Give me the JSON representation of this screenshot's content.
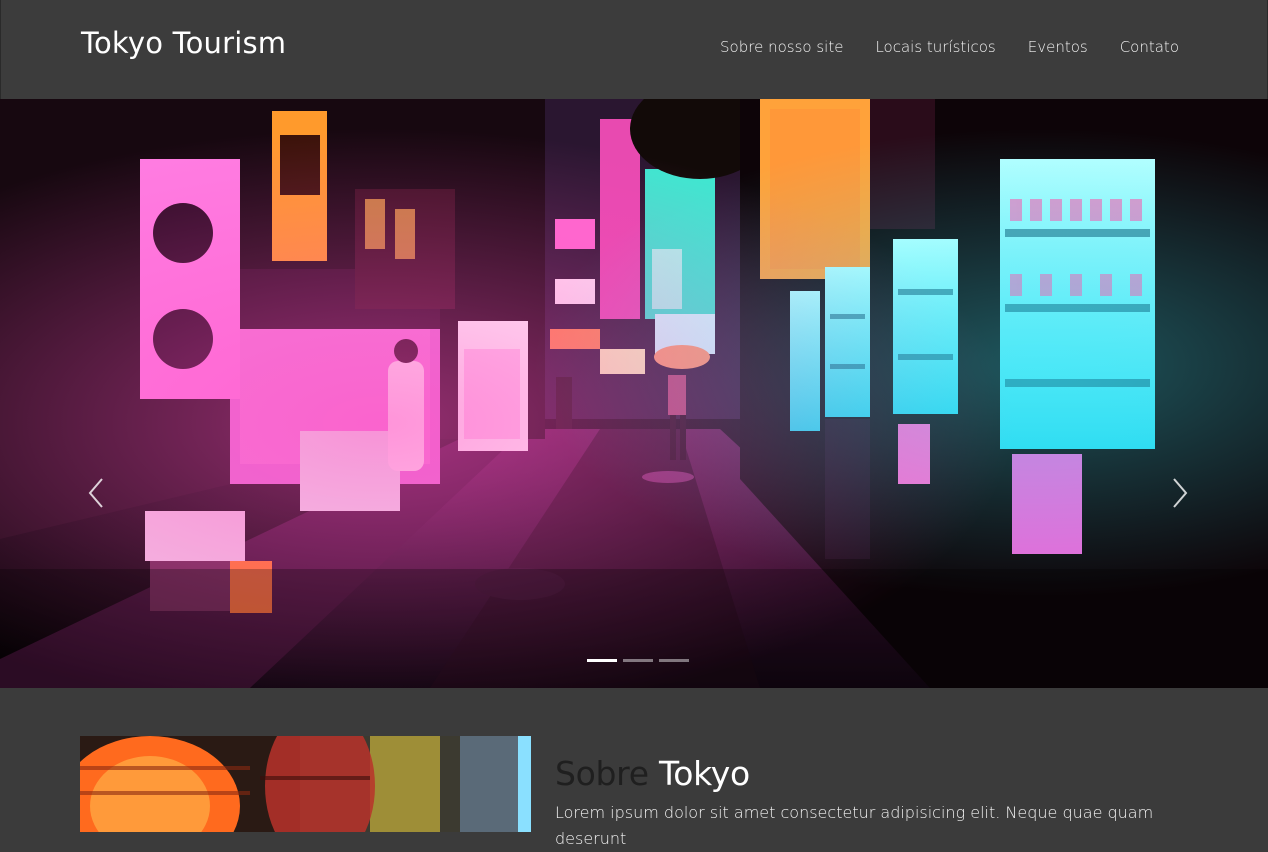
{
  "header": {
    "brand": "Tokyo Tourism",
    "nav": [
      "Sobre nosso site",
      "Locais turísticos",
      "Eventos",
      "Contato"
    ]
  },
  "carousel": {
    "slide_count": 3,
    "active_index": 0,
    "prev_icon": "chevron-left-icon",
    "next_icon": "chevron-right-icon"
  },
  "about": {
    "title_muted": "Sobre",
    "title_strong": "Tokyo",
    "text": "Lorem ipsum dolor sit amet consectetur adipisicing elit. Neque quae quam deserunt"
  },
  "colors": {
    "header_bg": "#3c3c3c",
    "section_bg": "#3b3b3b",
    "neon_pink": "#ff3db0",
    "neon_cyan": "#40f0ff"
  }
}
